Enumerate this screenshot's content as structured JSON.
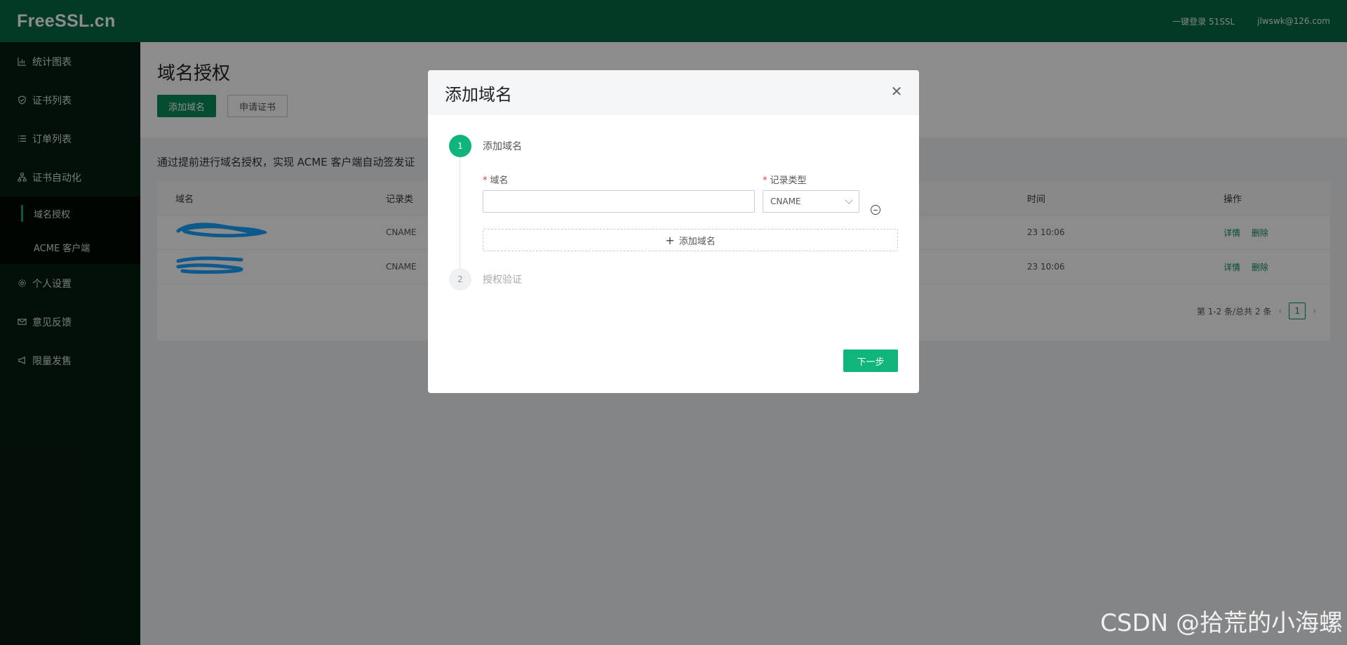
{
  "header": {
    "logo": "FreeSSL.cn",
    "login_link": "一键登录 51SSL",
    "user_email": "jlwswk@126.com"
  },
  "sidebar": {
    "items": [
      {
        "label": "统计图表",
        "icon": "bar-chart-icon"
      },
      {
        "label": "证书列表",
        "icon": "shield-icon"
      },
      {
        "label": "订单列表",
        "icon": "list-icon"
      },
      {
        "label": "证书自动化",
        "icon": "sitemap-icon"
      }
    ],
    "sub_items": [
      {
        "label": "域名授权",
        "active": true
      },
      {
        "label": "ACME 客户端",
        "active": false
      }
    ],
    "bottom_items": [
      {
        "label": "个人设置",
        "icon": "gear-icon"
      },
      {
        "label": "意见反馈",
        "icon": "mail-icon"
      },
      {
        "label": "限量发售",
        "icon": "megaphone-icon"
      }
    ]
  },
  "main": {
    "title": "域名授权",
    "add_domain_button": "添加域名",
    "apply_cert_button": "申请证书",
    "notice": "通过提前进行域名授权，实现 ACME 客户端自动签发证",
    "table": {
      "headers": [
        "域名",
        "记录类",
        "时间",
        "操作"
      ],
      "rows": [
        {
          "type": "CNAME",
          "time": "23 10:06",
          "detail": "详情",
          "delete": "删除"
        },
        {
          "type": "CNAME",
          "time": "23 10:06",
          "detail": "详情",
          "delete": "删除"
        }
      ]
    },
    "pagination": {
      "summary": "第 1-2 条/总共 2 条",
      "current": "1"
    }
  },
  "modal": {
    "title": "添加域名",
    "steps": [
      {
        "number": "1",
        "label": "添加域名"
      },
      {
        "number": "2",
        "label": "授权验证"
      }
    ],
    "domain_label": "域名",
    "domain_value": "",
    "record_type_label": "记录类型",
    "record_type_value": "CNAME",
    "add_row_button": "添加域名",
    "next_button": "下一步"
  },
  "watermark": "CSDN @拾荒的小海螺",
  "colors": {
    "header_bg": "#056b46",
    "sidebar_bg": "#051a0f",
    "accent": "#10b57c",
    "primary_button": "#0a8c5a"
  }
}
